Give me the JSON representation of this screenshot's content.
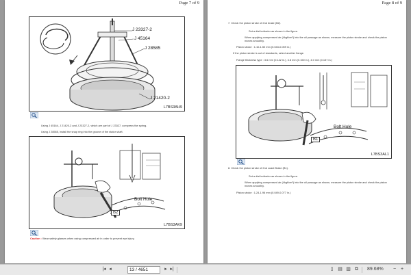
{
  "left_page": {
    "page_label": "Page 7 of 9",
    "figure1": {
      "callouts": [
        "J 23327-2",
        "J 45164",
        "J 28585",
        "J 21420-2"
      ],
      "code": "L7BS3AH9"
    },
    "instructions": [
      "Using J 45164, J 21420-2 and J 23327-2, which are part of J 23327, compress the spring.",
      "Using J 28585, install the snap ring into the groove of the stator shaft."
    ],
    "figure2": {
      "bolt_label": "Bolt Hole",
      "marker": "B2",
      "code": "L7BS3AK9"
    },
    "caution": {
      "label": "Caution :",
      "text": "Wear safety glasses when using compressed air in order to prevent eye injury."
    }
  },
  "right_page": {
    "page_label": "Page 8 of 9",
    "step7": {
      "number": "7.",
      "title": "Check the piston stroke of 2nd brake (B2).",
      "line1": "Set a dial indicator as shown in the figure.",
      "line2": "When applying compressed air (4kgf/cm²) into the oil passage as shown, measure the piston stroke and check the piston moves smoothly.",
      "spec": "Piston stroke : 1.10-1.50 mm (0.043-0.059 in.)",
      "note": "If the piston stroke is out of standards, select another flange.",
      "flange": "Flange thickness type : 3.6 mm (0.142 in.), 3.8 mm (0.150 in.), 4.0 mm (0.157 in.)"
    },
    "figure3": {
      "bolt_label": "Bolt Hole",
      "marker": "B1",
      "code": "L7BS3AL1"
    },
    "step8": {
      "number": "8.",
      "title": "Check the piston stroke of 2nd coast Brake (B1).",
      "line1": "Set a dial indicator as shown in the figure.",
      "line2": "When applying compressed air (4kgf/cm²) into the oil passage as shown, measure the piston stroke and check the piston moves smoothly.",
      "spec": "Piston stroke : 1.24-1.96 mm (0.049-0.077 in.)"
    }
  },
  "statusbar": {
    "page_field": "13 / 4651",
    "zoom": "89.68%"
  },
  "colors": {
    "caution": "#d22222",
    "background": "#9a9a9a",
    "statusbar": "#e9e9e9"
  }
}
